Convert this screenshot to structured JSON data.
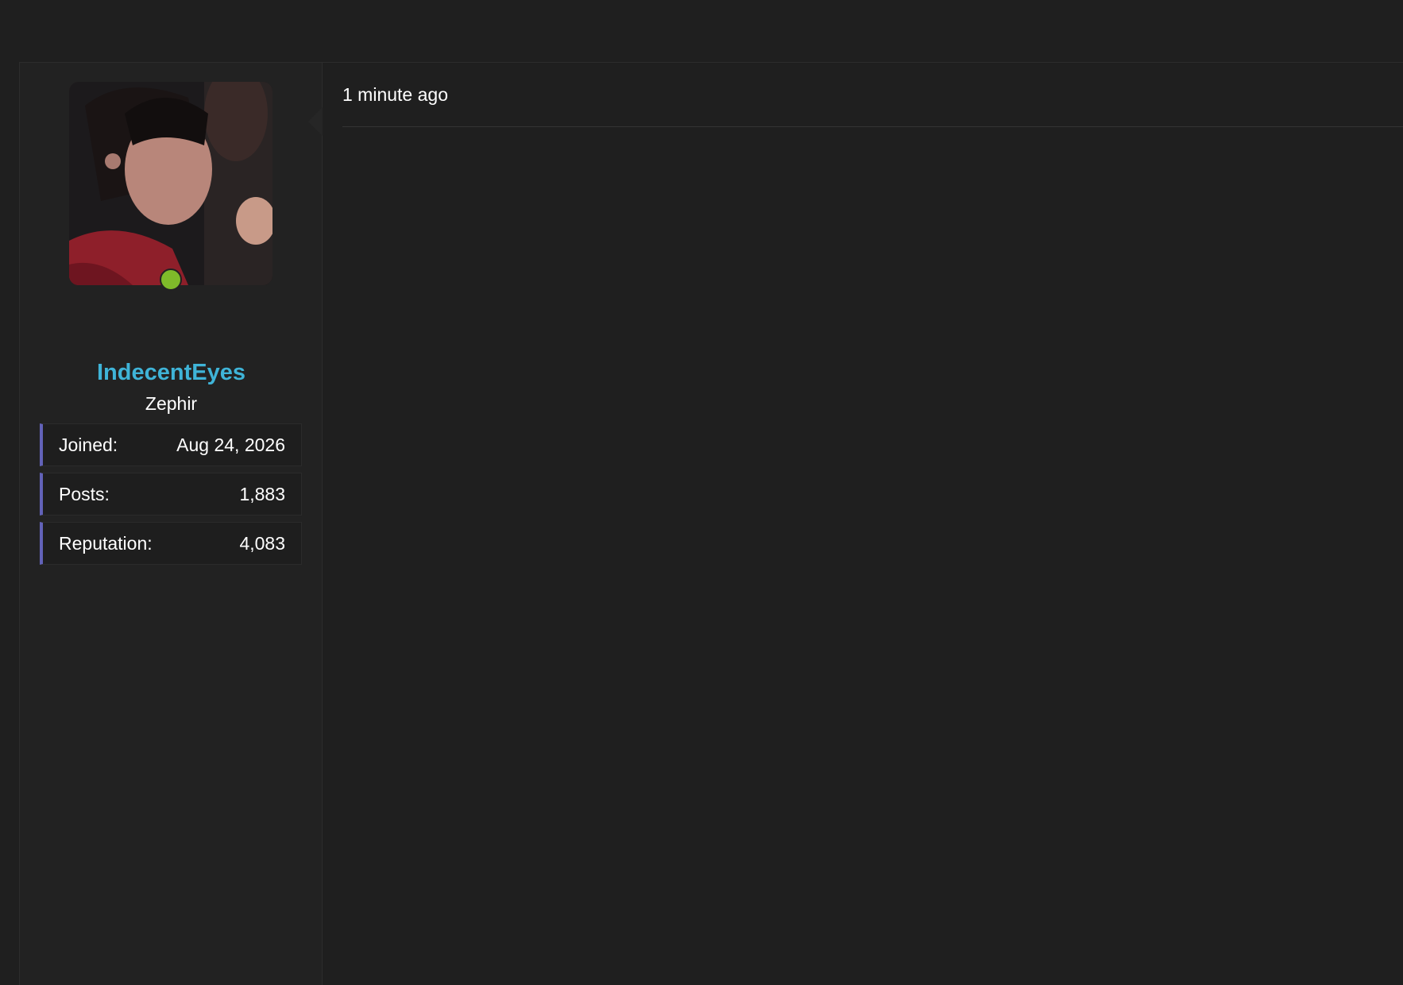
{
  "post": {
    "user": {
      "username": "IndecentEyes",
      "title": "Zephir",
      "online": true,
      "colors": {
        "username": "#3fb4d8",
        "online_dot": "#7fba2a",
        "stat_accent": "#6262b8"
      },
      "stats": [
        {
          "label": "Joined:",
          "value": "Aug 24, 2026"
        },
        {
          "label": "Posts:",
          "value": "1,883"
        },
        {
          "label": "Reputation:",
          "value": "4,083"
        }
      ]
    },
    "timestamp": "1 minute ago"
  }
}
